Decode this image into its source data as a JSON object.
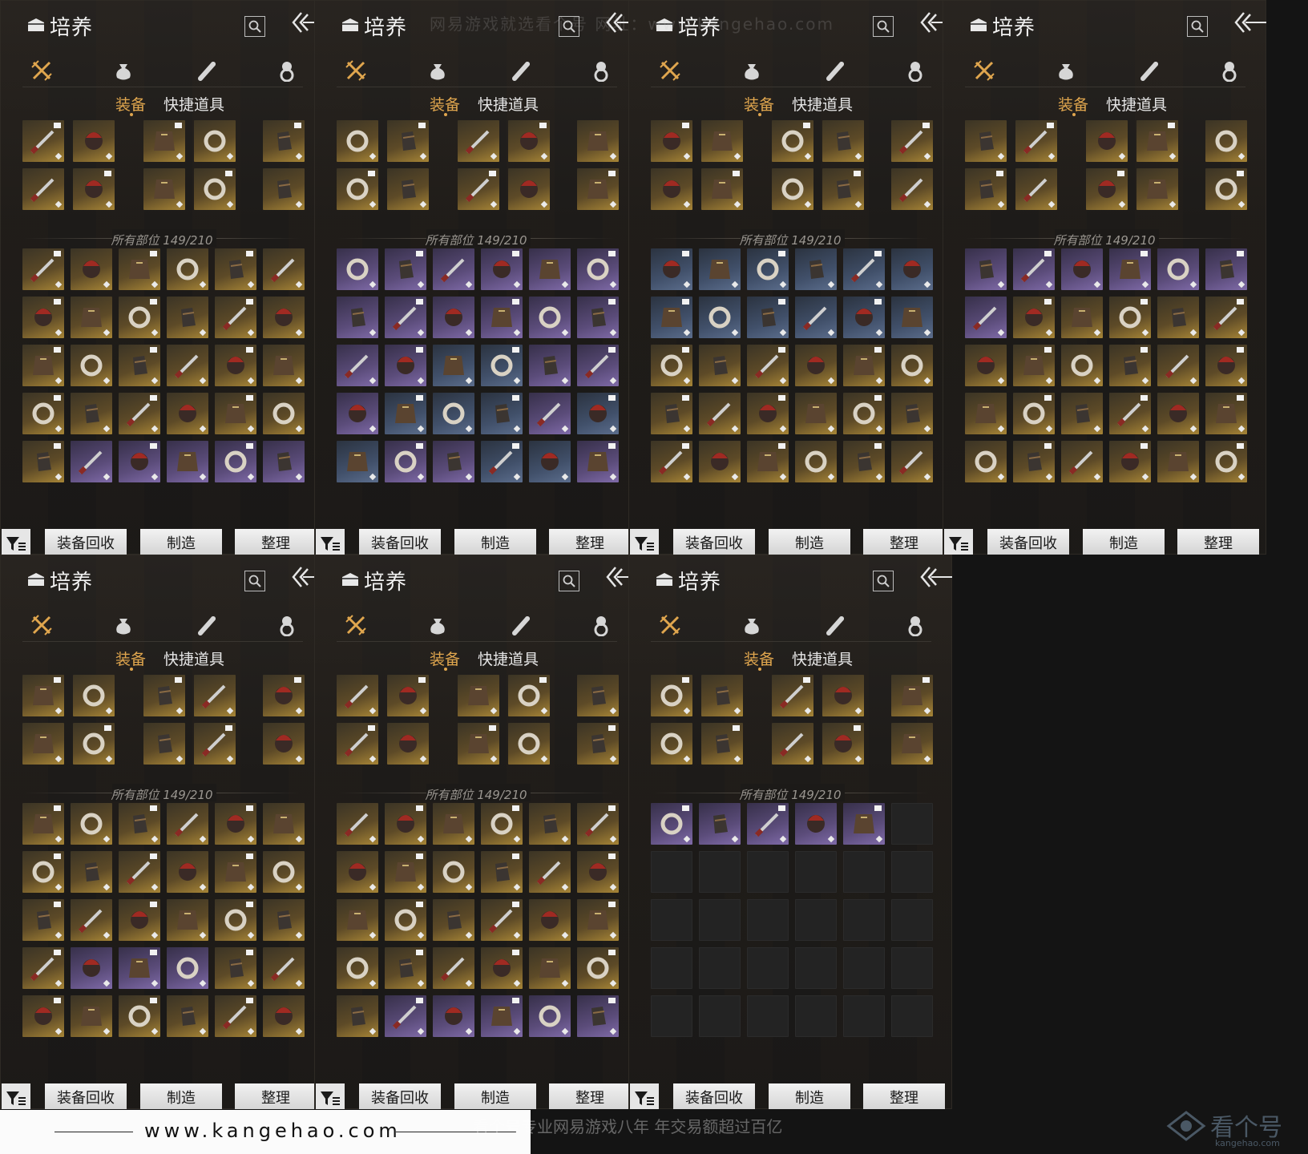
{
  "header": {
    "title": "培养"
  },
  "tabs": {
    "equipment": "装备",
    "quick_items": "快捷道具"
  },
  "buttons": {
    "recycle": "装备回收",
    "craft": "制造",
    "sort": "整理"
  },
  "inventory": {
    "label": "所有部位 149/210",
    "used": 149,
    "capacity": 210
  },
  "icons": {
    "title": "chest-icon",
    "search": "search-icon",
    "back": "back-arrow-icon",
    "categories": [
      "crossed-swords-icon",
      "pouch-icon",
      "scroll-icon",
      "gem-icon"
    ],
    "filter": "filter-icon"
  },
  "colors": {
    "accent": "#e0a64e",
    "gold_rarity": "#a78536",
    "purple_rarity": "#7f6aa8",
    "blue_rarity": "#5b6d8c"
  },
  "watermarks": {
    "top": "网易游戏就选看个号  网址：www.kangehao.com",
    "footer_url": "www.kangehao.com",
    "bottom": "看个号专业网易游戏八年 年交易额超过百亿",
    "logo": "看个号",
    "logo_domain": "kangehao.com"
  },
  "panels": [
    {
      "grid": "gggggggggggggggggggggggggppppppppppp"
    },
    {
      "grid": "ppppppppppppppbbpppbbbpbbppbbpppbpbb"
    },
    {
      "grid": "bbbbbbbbbbbbgggggggggggggggggggggggg"
    },
    {
      "grid": "pppppppggggggggggggggggggggggggggggg"
    },
    {
      "grid": "gggggggggggggggggggpppgggggggggggggg"
    },
    {
      "grid": "gggggggggggggggggggggggggpppppppppppe"
    },
    {
      "grid": "pppppeeeeeeeeeeeeeeeeeeeeeeeeeeeeeee"
    }
  ]
}
